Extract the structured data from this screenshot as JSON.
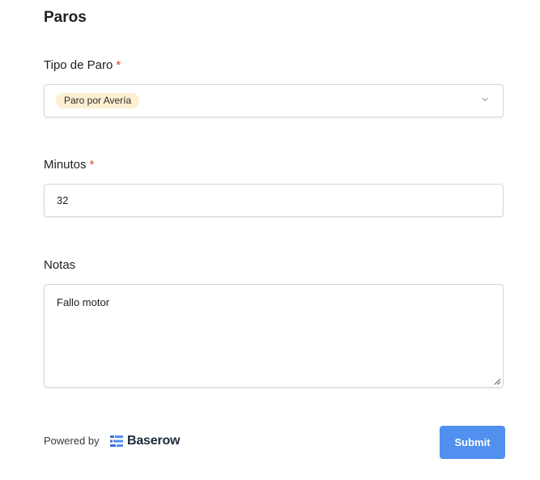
{
  "form": {
    "title": "Paros"
  },
  "fields": {
    "tipo_de_paro": {
      "label": "Tipo de Paro",
      "required_mark": "*",
      "selected_value": "Paro por Avería",
      "chip_color": "#fdf0d1"
    },
    "minutos": {
      "label": "Minutos",
      "required_mark": "*",
      "value": "32"
    },
    "notas": {
      "label": "Notas",
      "value": "Fallo motor"
    }
  },
  "footer": {
    "powered_by": "Powered by",
    "brand_name": "Baserow",
    "submit_label": "Submit"
  },
  "icons": {
    "select_chevron": "chevron-down-icon",
    "brand_logo": "baserow-logo-icon",
    "resize": "resize-handle-icon"
  },
  "colors": {
    "required": "#e8412c",
    "submit_button": "#5190ef",
    "brand_text": "#1e2b3c"
  }
}
